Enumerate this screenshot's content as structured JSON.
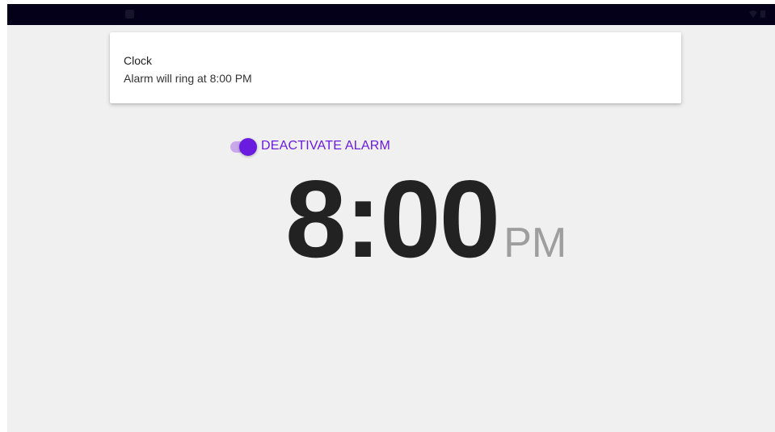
{
  "status_bar": {
    "left_text": "",
    "right_text": ""
  },
  "notification": {
    "app_name": "Clock",
    "message": "Alarm will ring at 8:00 PM"
  },
  "alarm_toggle": {
    "label": "DEACTIVATE ALARM",
    "on": true
  },
  "clock": {
    "time": "8:00",
    "ampm": "PM"
  },
  "colors": {
    "accent": "#6a1be0",
    "background": "#f0f0f0",
    "status_bar": "#04001a",
    "time_text": "#222222",
    "ampm_text": "#9e9e9e"
  }
}
